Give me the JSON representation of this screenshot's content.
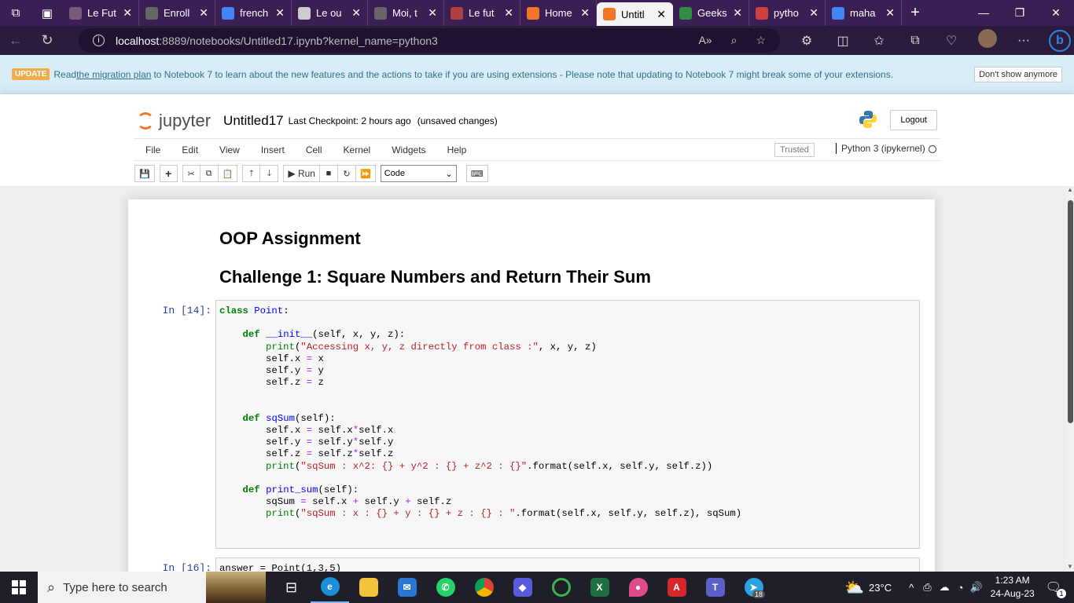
{
  "browser": {
    "tabs": [
      {
        "title": "Le Fut",
        "fav_color": "#7a5a7a"
      },
      {
        "title": "Enroll",
        "fav_color": "#666666"
      },
      {
        "title": "french",
        "fav_color": "#4285f4"
      },
      {
        "title": "Le ou",
        "fav_color": "#cccccc"
      },
      {
        "title": "Moi, t",
        "fav_color": "#666666"
      },
      {
        "title": "Le fut",
        "fav_color": "#b04040"
      },
      {
        "title": "Home",
        "fav_color": "#f37626"
      },
      {
        "title": "Untitl",
        "fav_color": "#f37626",
        "active": true
      },
      {
        "title": "Geeks",
        "fav_color": "#2f8d46"
      },
      {
        "title": "pytho",
        "fav_color": "#d04040"
      },
      {
        "title": "maha",
        "fav_color": "#4285f4"
      }
    ],
    "url_host": "localhost",
    "url_path": ":8889/notebooks/Untitled17.ipynb?kernel_name=python3"
  },
  "banner": {
    "badge": "UPDATE",
    "text_before": "Read ",
    "link": "the migration plan",
    "text_after": " to Notebook 7 to learn about the new features and the actions to take if you are using extensions - Please note that updating to Notebook 7 might break some of your extensions.",
    "dismiss": "Don't show anymore"
  },
  "header": {
    "logo_text": "jupyter",
    "notebook_name": "Untitled17",
    "checkpoint": "Last Checkpoint: 2 hours ago",
    "unsaved": "(unsaved changes)",
    "logout": "Logout"
  },
  "menu": {
    "items": [
      "File",
      "Edit",
      "View",
      "Insert",
      "Cell",
      "Kernel",
      "Widgets",
      "Help"
    ],
    "trusted": "Trusted",
    "kernel": "Python 3 (ipykernel)"
  },
  "toolbar": {
    "run": "Run",
    "cell_type": "Code"
  },
  "notebook": {
    "heading1": "OOP Assignment",
    "heading2": "Challenge 1: Square Numbers and Return Their Sum",
    "prompt1": "In [14]:",
    "prompt2": "In [16]:",
    "cell2_code": "answer = Point(1,3,5)"
  },
  "taskbar": {
    "search_placeholder": "Type here to search",
    "temperature": "23°C",
    "time": "1:23 AM",
    "date": "24-Aug-23",
    "notif_count": "1",
    "telegram_badge": "18"
  }
}
